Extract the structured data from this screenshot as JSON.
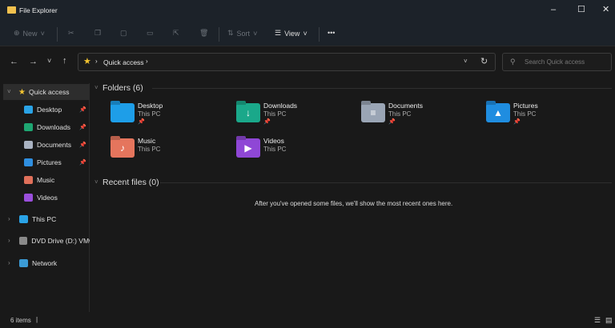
{
  "window": {
    "title": "File Explorer",
    "controls": [
      "–",
      "☐",
      "✕"
    ]
  },
  "toolbar": {
    "new": "New",
    "sort": "Sort",
    "view": "View",
    "more": "•••"
  },
  "nav": {
    "path": "Quick access",
    "search_placeholder": "Search Quick access"
  },
  "sidebar": {
    "quick_access": "Quick access",
    "items": [
      {
        "label": "Desktop",
        "pinned": true,
        "color": "#2aa3e6"
      },
      {
        "label": "Downloads",
        "pinned": true,
        "color": "#1ea672"
      },
      {
        "label": "Documents",
        "pinned": true,
        "color": "#aab3c2"
      },
      {
        "label": "Pictures",
        "pinned": true,
        "color": "#2f8fe0"
      },
      {
        "label": "Music",
        "pinned": false,
        "color": "#e0705a"
      },
      {
        "label": "Videos",
        "pinned": false,
        "color": "#9a4fdc"
      }
    ],
    "roots": [
      {
        "label": "This PC"
      },
      {
        "label": "DVD Drive (D:) VMw"
      },
      {
        "label": "Network"
      }
    ]
  },
  "main": {
    "folders_header": "Folders (6)",
    "folders": [
      {
        "name": "Desktop",
        "location": "This PC",
        "pinned": true,
        "color": "#1e9ee8",
        "glyph": ""
      },
      {
        "name": "Downloads",
        "location": "This PC",
        "pinned": true,
        "color": "#1aa88a",
        "glyph": "↓"
      },
      {
        "name": "Documents",
        "location": "This PC",
        "pinned": true,
        "color": "#9aa5b5",
        "glyph": "≡"
      },
      {
        "name": "Pictures",
        "location": "This PC",
        "pinned": true,
        "color": "#1f8de0",
        "glyph": "▲"
      },
      {
        "name": "Music",
        "location": "This PC",
        "pinned": false,
        "color": "#e5755d",
        "glyph": "♪"
      },
      {
        "name": "Videos",
        "location": "This PC",
        "pinned": false,
        "color": "#8f47d6",
        "glyph": "▶"
      }
    ],
    "recent_header": "Recent files (0)",
    "empty_message": "After you've opened some files, we'll show the most recent ones here."
  },
  "status": {
    "items": "6 items"
  }
}
